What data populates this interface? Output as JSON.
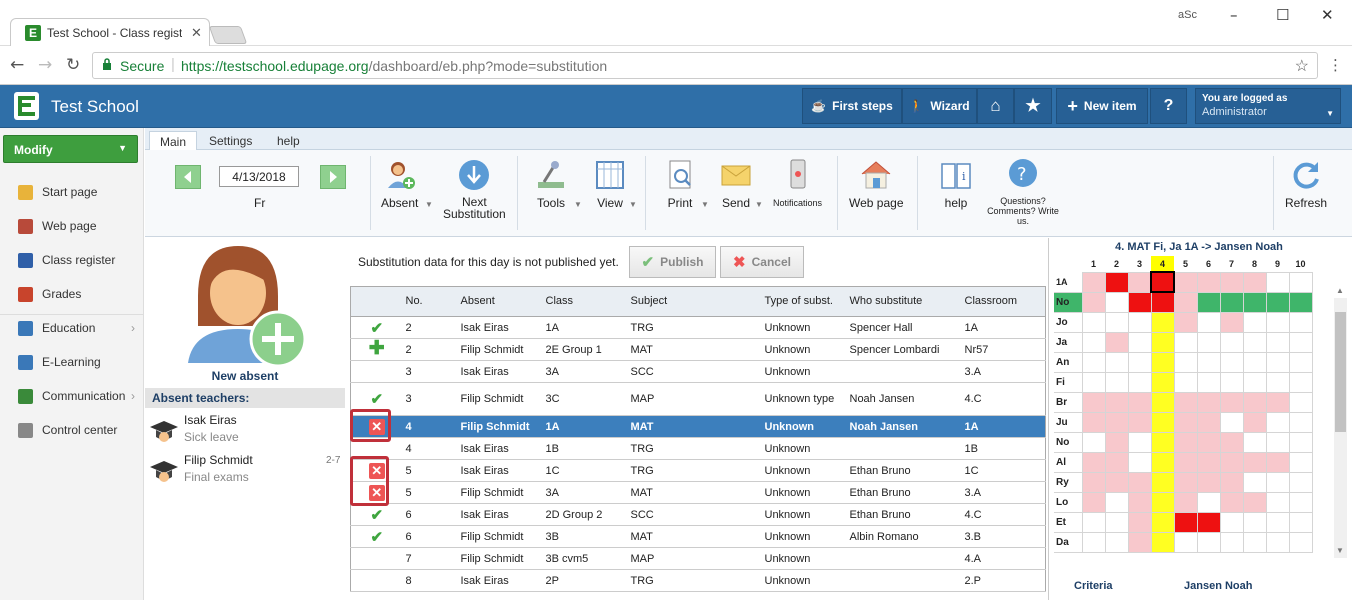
{
  "browser": {
    "tab_title": "Test School - Class regist",
    "secure_label": "Secure",
    "url_host": "https://testschool.edupage.org",
    "url_path": "/dashboard/eb.php?mode=substitution",
    "window_tag": "aSc"
  },
  "header": {
    "school_name": "Test School",
    "first_steps": "First steps",
    "wizard": "Wizard",
    "new_item": "New item",
    "help": "?",
    "logged_as_label": "You are logged as",
    "user_role": "Administrator"
  },
  "sidebar": {
    "modify_label": "Modify",
    "items": [
      {
        "label": "Start page",
        "color": "#e8b33a",
        "chevron": false
      },
      {
        "label": "Web page",
        "color": "#b84a3a",
        "chevron": false
      },
      {
        "label": "Class register",
        "color": "#2f5fa8",
        "chevron": false
      },
      {
        "label": "Grades",
        "color": "#c8442c",
        "chevron": false
      },
      {
        "label": "Education",
        "color": "#3a78b8",
        "chevron": true
      },
      {
        "label": "E-Learning",
        "color": "#3a78b8",
        "chevron": false
      },
      {
        "label": "Communication",
        "color": "#3a8a3a",
        "chevron": true
      },
      {
        "label": "Control center",
        "color": "#888888",
        "chevron": false
      }
    ]
  },
  "ribbon": {
    "tabs": [
      "Main",
      "Settings",
      "help"
    ],
    "active_tab": "Main",
    "date": "4/13/2018",
    "day": "Fr",
    "absent": "Absent",
    "next_sub_1": "Next",
    "next_sub_2": "Substitution",
    "tools": "Tools",
    "view": "View",
    "print": "Print",
    "send": "Send",
    "notifications": "Notifications",
    "web_page": "Web page",
    "help": "help",
    "questions": "Questions? Comments? Write us.",
    "refresh": "Refresh"
  },
  "left_panel": {
    "new_absent": "New absent",
    "absent_teachers_title": "Absent teachers:",
    "teachers": [
      {
        "name": "Isak Eiras",
        "reason": "Sick leave",
        "range": ""
      },
      {
        "name": "Filip Schmidt",
        "reason": "Final exams",
        "range": "2-7"
      }
    ]
  },
  "main": {
    "notice": "Substitution data for this day is not published yet.",
    "publish": "Publish",
    "cancel": "Cancel",
    "columns": [
      "No.",
      "Absent",
      "Class",
      "Subject",
      "Type of subst.",
      "Who substitute",
      "Classroom"
    ],
    "rows": [
      {
        "status": "check",
        "no": "2",
        "absent": "Isak Eiras",
        "class": "1A",
        "subject": "TRG",
        "type": "Unknown",
        "who": "Spencer Hall",
        "room": "1A"
      },
      {
        "status": "plus",
        "no": "2",
        "absent": "Filip Schmidt",
        "class": "2E Group 1",
        "subject": "MAT",
        "type": "Unknown",
        "who": "Spencer Lombardi",
        "room": "Nr57"
      },
      {
        "status": "",
        "no": "3",
        "absent": "Isak Eiras",
        "class": "3A",
        "subject": "SCC",
        "type": "Unknown",
        "who": "",
        "room": "3.A"
      },
      {
        "status": "check",
        "no": "3",
        "absent": "Filip Schmidt",
        "class": "3C",
        "subject": "MAP",
        "type": "Unknown type",
        "who": "Noah Jansen",
        "room": "4.C"
      },
      {
        "status": "x",
        "no": "4",
        "absent": "Filip Schmidt",
        "class": "1A",
        "subject": "MAT",
        "type": "Unknown",
        "who": "Noah Jansen",
        "room": "1A"
      },
      {
        "status": "",
        "no": "4",
        "absent": "Isak Eiras",
        "class": "1B",
        "subject": "TRG",
        "type": "Unknown",
        "who": "",
        "room": "1B"
      },
      {
        "status": "x",
        "no": "5",
        "absent": "Isak Eiras",
        "class": "1C",
        "subject": "TRG",
        "type": "Unknown",
        "who": "Ethan Bruno",
        "room": "1C"
      },
      {
        "status": "x",
        "no": "5",
        "absent": "Filip Schmidt",
        "class": "3A",
        "subject": "MAT",
        "type": "Unknown",
        "who": "Ethan Bruno",
        "room": "3.A"
      },
      {
        "status": "check",
        "no": "6",
        "absent": "Isak Eiras",
        "class": "2D Group 2",
        "subject": "SCC",
        "type": "Unknown",
        "who": "Ethan Bruno",
        "room": "4.C"
      },
      {
        "status": "check",
        "no": "6",
        "absent": "Filip Schmidt",
        "class": "3B",
        "subject": "MAT",
        "type": "Unknown",
        "who": "Albin Romano",
        "room": "3.B"
      },
      {
        "status": "",
        "no": "7",
        "absent": "Filip Schmidt",
        "class": "3B cvm5",
        "subject": "MAP",
        "type": "Unknown",
        "who": "",
        "room": "4.A"
      },
      {
        "status": "",
        "no": "8",
        "absent": "Isak Eiras",
        "class": "2P",
        "subject": "TRG",
        "type": "Unknown",
        "who": "",
        "room": "2.P"
      }
    ],
    "selected_index": 4
  },
  "grid": {
    "title": "4. MAT Fi, Ja 1A -> Jansen Noah",
    "periods": [
      "1",
      "2",
      "3",
      "4",
      "5",
      "6",
      "7",
      "8",
      "9",
      "10"
    ],
    "highlight_period": "4",
    "rows": [
      {
        "label": "1A",
        "cells": "PRPRPPPP.."
      },
      {
        "label": "No",
        "cells": "P.RRPGGGGG"
      },
      {
        "label": "Jo",
        "cells": "...YP.P..."
      },
      {
        "label": "Ja",
        "cells": ".P.Y......"
      },
      {
        "label": "An",
        "cells": "...Y......"
      },
      {
        "label": "Fi",
        "cells": "...Y......"
      },
      {
        "label": "Br",
        "cells": "PPPYPPPPP."
      },
      {
        "label": "Ju",
        "cells": "PPPYPP.P.."
      },
      {
        "label": "No",
        "cells": ".P.YPPP..."
      },
      {
        "label": "Al",
        "cells": "PP.YPPPPP."
      },
      {
        "label": "Ry",
        "cells": "PPPYPPP..."
      },
      {
        "label": "Lo",
        "cells": "P.PYP.PP.."
      },
      {
        "label": "Et",
        "cells": "..PYRR...."
      },
      {
        "label": "Da",
        "cells": "..PY......"
      }
    ],
    "criteria_label": "Criteria",
    "criteria_value": "Jansen Noah"
  }
}
